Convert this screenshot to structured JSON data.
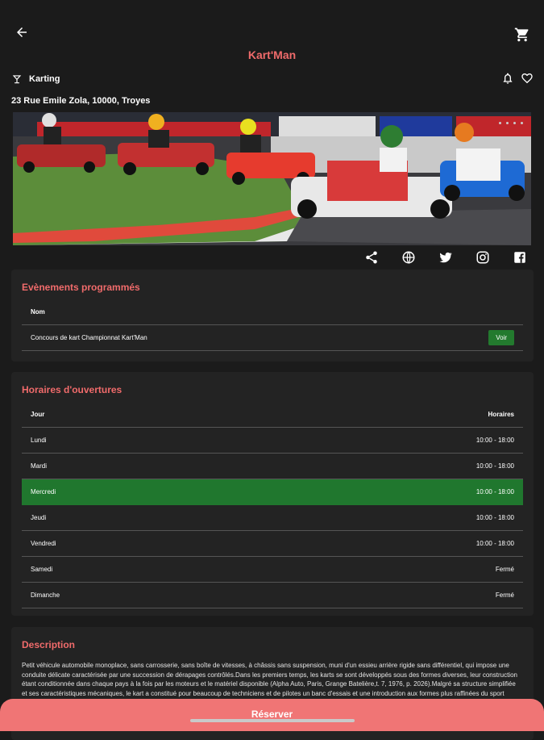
{
  "header": {
    "title": "Kart'Man"
  },
  "category": "Karting",
  "address": "23 Rue Emile Zola, 10000, Troyes",
  "events": {
    "title": "Evènements programmés",
    "column": "Nom",
    "rows": [
      {
        "name": "Concours de kart Championnat Kart'Man",
        "action": "Voir"
      }
    ]
  },
  "hours": {
    "title": "Horaires d'ouvertures",
    "columns": [
      "Jour",
      "Horaires"
    ],
    "rows": [
      {
        "day": "Lundi",
        "hours": "10:00 - 18:00"
      },
      {
        "day": "Mardi",
        "hours": "10:00 - 18:00"
      },
      {
        "day": "Mercredi",
        "hours": "10:00 - 18:00"
      },
      {
        "day": "Jeudi",
        "hours": "10:00 - 18:00"
      },
      {
        "day": "Vendredi",
        "hours": "10:00 - 18:00"
      },
      {
        "day": "Samedi",
        "hours": "Fermé"
      },
      {
        "day": "Dimanche",
        "hours": "Fermé"
      }
    ],
    "highlight_color": "#20772e"
  },
  "description": {
    "title": "Description",
    "text": "Petit véhicule automobile monoplace, sans carrosserie, sans boîte de vitesses, à châssis sans suspension, muni d'un essieu arrière rigide sans différentiel, qui impose une conduite délicate caractérisée par une succession de dérapages contrôlés.Dans les premiers temps, les karts se sont développés sous des formes diverses, leur construction étant conditionnée dans chaque pays à la fois par les moteurs et le matériel disponible (Alpha Auto, Paris, Grange Batelière,t. 7, 1976, p. 2026).Malgré sa structure simplifiée et ses caractéristiques mécaniques, le kart a constitué pour beaucoup de techniciens et de pilotes un banc d'essais et une introduction aux formes plus raffinées du sport automobile (Alpha Auto. Paris"
  },
  "cta": {
    "reserve": "Réserver"
  },
  "colors": {
    "accent": "#f06b6b",
    "background": "#1b1b1b",
    "card": "#232323"
  }
}
